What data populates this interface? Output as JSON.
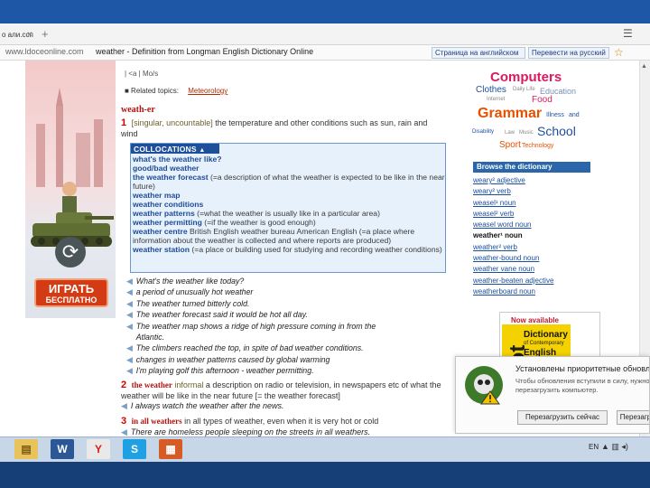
{
  "colors": {
    "accent_blue": "#1d4f9d",
    "headword_red": "#b5120f",
    "ad_button": "#d23b14",
    "link_blue": "#1c4fa0"
  },
  "browser": {
    "tab_label": "о али.ссп",
    "tab_close": "×",
    "tab_new": "+",
    "menu_icon": "☰",
    "url": "www.ldoceonline.com",
    "page_title": "weather - Definition from Longman English Dictionary Online",
    "translate_page": "Страница на английском",
    "translate_to_ru": "Перевести на русский",
    "favorite_icon": "☆"
  },
  "ad": {
    "button_line1": "ИГРАТЬ",
    "button_line2": "БЕСПЛАТНО",
    "reload_icon": "⟳"
  },
  "entry": {
    "breadcrumb": "| <a | Mo/s",
    "related_label": "■ Related topics:",
    "related_topic": "Meteorology",
    "headword": "weath-er",
    "sense1": {
      "num": "1",
      "grammar": "[singular, uncountable]",
      "definition": "the temperature and other conditions such as sun, rain and wind"
    },
    "collocations": {
      "header": "COLLOCATIONS",
      "toggle_icon": "▲",
      "lines": [
        {
          "b": "what's the weather like?",
          "t": ""
        },
        {
          "b": "good/bad weather",
          "t": ""
        },
        {
          "b": "the weather forecast",
          "t": " (=a description of what the weather is expected to be like in the near future)"
        },
        {
          "b": "weather map",
          "t": ""
        },
        {
          "b": "weather conditions",
          "t": ""
        },
        {
          "b": "weather patterns",
          "t": " (=what the weather is usually like in a particular area)"
        },
        {
          "b": "weather permitting",
          "t": " (=if the weather is good enough)"
        },
        {
          "b": "weather centre",
          "t": " British English weather bureau American English (=a place where information about the weather is collected and where reports are produced)"
        },
        {
          "b": "weather station",
          "t": " (=a place or building used for studying and recording weather conditions)"
        }
      ]
    },
    "examples": [
      "What's the weather like today?",
      "a period of unusually hot weather",
      "The weather turned bitterly cold.",
      "The weather forecast said it would be hot all day.",
      "The weather map shows a ridge of high pressure coming in from the",
      "Atlantic.",
      "The climbers reached the top, in spite of bad weather conditions.",
      "changes in weather patterns caused by global warming",
      "I'm playing golf this afternoon - weather permitting."
    ],
    "speaker_icon": "◀",
    "sense2": {
      "num": "2",
      "phrase": "the weather",
      "label": "informal",
      "definition": "a description on radio or television, in newspapers etc of what the weather will be like in the near future [= the weather forecast]",
      "example": "I always watch the weather after the news."
    },
    "sense3": {
      "num": "3",
      "phrase": "in all weathers",
      "definition": "in all types of weather, even when it is very hot or cold",
      "example": "There are homeless people sleeping on the streets in all weathers."
    }
  },
  "topic_cloud": [
    {
      "text": "Computers",
      "size": 15,
      "color": "#d81b60",
      "bold": true
    },
    {
      "text": "Clothes",
      "size": 10,
      "color": "#1d4f9d",
      "bold": false
    },
    {
      "text": "Daily Life",
      "size": 6,
      "color": "#888888",
      "bold": false
    },
    {
      "text": "Education",
      "size": 9,
      "color": "#7b8fb8",
      "bold": false
    },
    {
      "text": "Internet",
      "size": 6,
      "color": "#888888",
      "bold": false
    },
    {
      "text": "Food",
      "size": 10,
      "color": "#d81b60",
      "bold": false
    },
    {
      "text": "Grammar",
      "size": 16,
      "color": "#e65100",
      "bold": true
    },
    {
      "text": "Illness",
      "size": 7,
      "color": "#1d4f9d",
      "bold": false
    },
    {
      "text": "and",
      "size": 7,
      "color": "#1d4f9d",
      "bold": false
    },
    {
      "text": "Disability",
      "size": 6,
      "color": "#1d4f9d",
      "bold": false
    },
    {
      "text": "Law",
      "size": 6,
      "color": "#888888",
      "bold": false
    },
    {
      "text": "Music",
      "size": 6,
      "color": "#888888",
      "bold": false
    },
    {
      "text": "School",
      "size": 14,
      "color": "#1d4f9d",
      "bold": false
    },
    {
      "text": "Sport",
      "size": 10,
      "color": "#e65100",
      "bold": false
    },
    {
      "text": "Technology",
      "size": 7,
      "color": "#e65100",
      "bold": false
    }
  ],
  "browse": {
    "header": "Browse the dictionary",
    "items": [
      {
        "text": "weary² adjective",
        "current": false
      },
      {
        "text": "weary² verb",
        "current": false
      },
      {
        "text": "weasel¹ noun",
        "current": false
      },
      {
        "text": "weasel² verb",
        "current": false
      },
      {
        "text": "weasel word noun",
        "current": false
      },
      {
        "text": "weather¹ noun",
        "current": true
      },
      {
        "text": "weather² verb",
        "current": false
      },
      {
        "text": "weather-bound noun",
        "current": false
      },
      {
        "text": "weather vane noun",
        "current": false
      },
      {
        "text": "weather-beaten adjective",
        "current": false
      },
      {
        "text": "weatherboard noun",
        "current": false
      }
    ]
  },
  "book_ad": {
    "now_available": "Now available",
    "side_text": "lot",
    "title1": "Dictionary",
    "title2": "of Contemporary",
    "title3": "English"
  },
  "notification": {
    "title": "Установлены приоритетные обновл",
    "body": "Чтобы обновления вступили в силу, нужно перезагрузить компьютер.",
    "restart_now": "Перезагрузить сейчас",
    "later": "Перезагр"
  },
  "taskbar": {
    "apps": [
      {
        "name": "explorer",
        "glyph": "▤"
      },
      {
        "name": "word",
        "glyph": "W"
      },
      {
        "name": "yandex",
        "glyph": "Y"
      },
      {
        "name": "skype",
        "glyph": "S"
      },
      {
        "name": "presentation",
        "glyph": "▦"
      }
    ],
    "lang": "EN",
    "tray": "▲ ▥ ◂)"
  }
}
